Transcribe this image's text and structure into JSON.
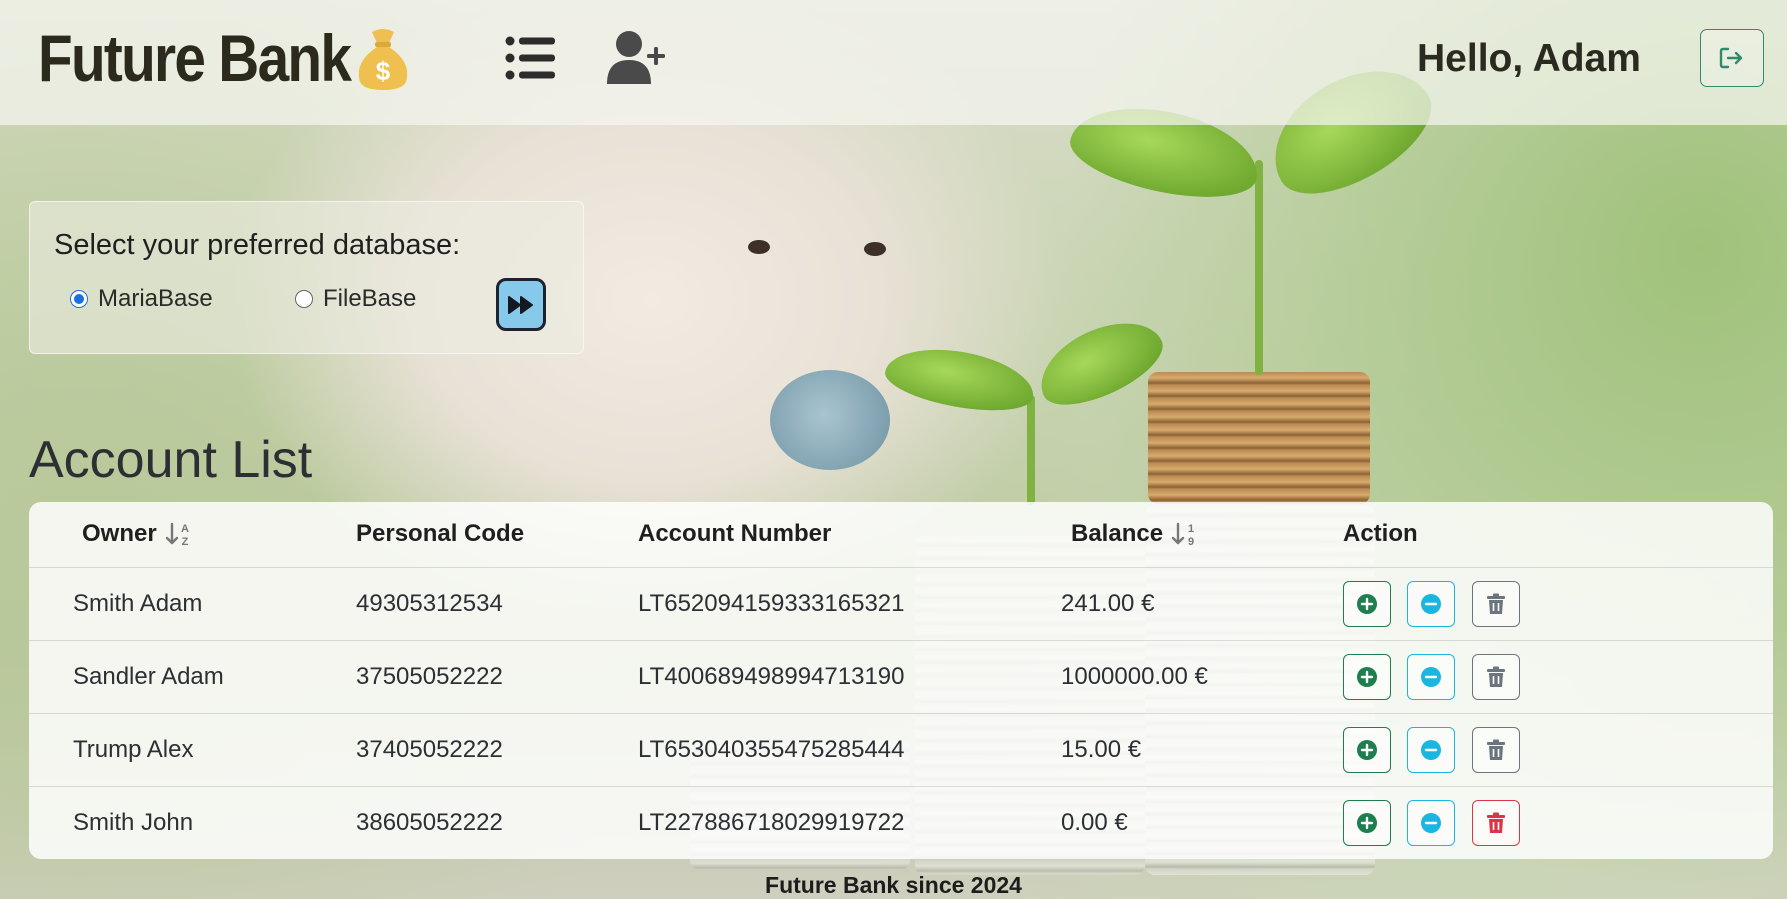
{
  "header": {
    "brand": "Future Bank",
    "greeting": "Hello, Adam"
  },
  "database": {
    "title": "Select your preferred database:",
    "options": [
      {
        "label": "MariaBase",
        "selected": true
      },
      {
        "label": "FileBase",
        "selected": false
      }
    ]
  },
  "page": {
    "heading": "Account List"
  },
  "table": {
    "headers": {
      "owner": "Owner",
      "personal_code": "Personal Code",
      "account_number": "Account Number",
      "balance": "Balance",
      "action": "Action"
    },
    "rows": [
      {
        "owner": "Smith Adam",
        "personal_code": "49305312534",
        "account_number": "LT652094159333165321",
        "balance": "241.00 €"
      },
      {
        "owner": "Sandler Adam",
        "personal_code": "37505052222",
        "account_number": "LT400689498994713190",
        "balance": "1000000.00 €"
      },
      {
        "owner": "Trump Alex",
        "personal_code": "37405052222",
        "account_number": "LT653040355475285444",
        "balance": "15.00 €"
      },
      {
        "owner": "Smith John",
        "personal_code": "38605052222",
        "account_number": "LT227886718029919722",
        "balance": "0.00 €"
      }
    ]
  },
  "footer": {
    "text": "Future Bank since 2024"
  },
  "icons": {
    "brand": "money-bag-icon",
    "nav_list": "list-icon",
    "nav_add_user": "user-plus-icon",
    "logout": "logout-icon",
    "submit": "fast-forward-icon",
    "sort_owner": "sort-alpha-icon",
    "sort_balance": "sort-numeric-icon",
    "deposit": "plus-circle-icon",
    "withdraw": "minus-circle-icon",
    "delete": "trash-icon"
  },
  "colors": {
    "deposit": "#1e7e4e",
    "withdraw": "#1bb6e0",
    "delete": "#6c757d",
    "delete_danger": "#dc3545",
    "logout": "#2e8b6b",
    "submit_bg": "#86c9eb",
    "radio_selected": "#1a6fe0"
  }
}
